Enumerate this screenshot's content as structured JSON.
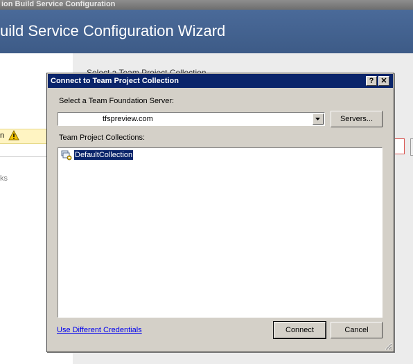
{
  "background": {
    "window_title": "ion Build Service Configuration",
    "wizard_title": "uild Service Configuration Wizard",
    "sidebar": {
      "warning_item_text": "n",
      "secondary_item_text": "ks"
    },
    "section_title": "Select a Team Project Collection"
  },
  "dialog": {
    "title": "Connect to Team Project Collection",
    "help_button": "?",
    "close_button": "✕",
    "server_label": "Select a Team Foundation Server:",
    "server_value": "tfspreview.com",
    "servers_button": "Servers...",
    "collections_label": "Team Project Collections:",
    "collections": [
      {
        "name": "DefaultCollection",
        "selected": true
      }
    ],
    "credentials_link": "Use Different Credentials",
    "connect_button": "Connect",
    "cancel_button": "Cancel"
  },
  "colors": {
    "dialog_title_bar": "#0a246a",
    "wizard_header": "#3d5b87",
    "selection": "#0a246a",
    "link": "#0000ee",
    "warning": "#f5c400"
  }
}
